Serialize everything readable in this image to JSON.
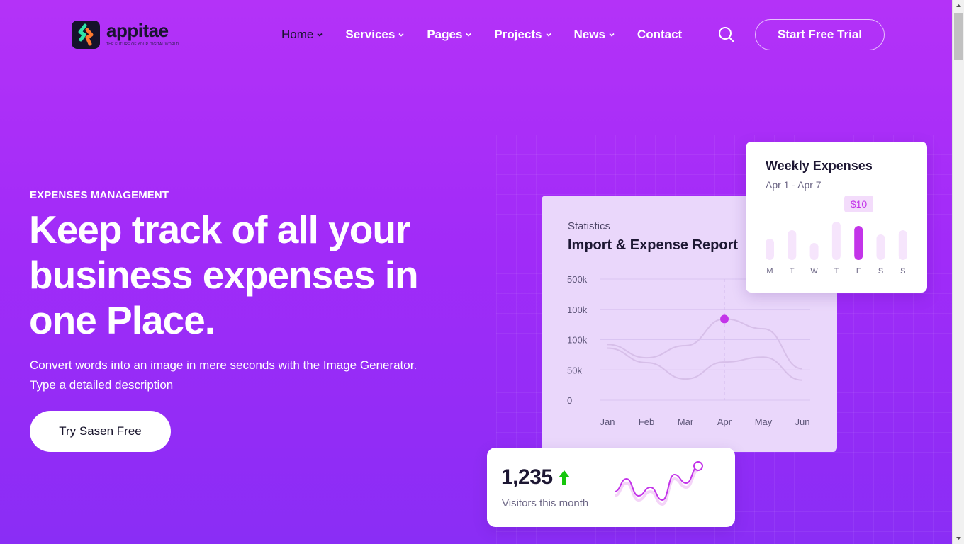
{
  "brand": {
    "name": "appitae",
    "tagline": "THE FUTURE OF YOUR DIGITAL WORLD"
  },
  "nav": {
    "items": [
      {
        "label": "Home",
        "has_dropdown": true,
        "active": true
      },
      {
        "label": "Services",
        "has_dropdown": true
      },
      {
        "label": "Pages",
        "has_dropdown": true
      },
      {
        "label": "Projects",
        "has_dropdown": true
      },
      {
        "label": "News",
        "has_dropdown": true
      },
      {
        "label": "Contact",
        "has_dropdown": false
      }
    ],
    "search_icon": "search-icon",
    "cta_label": "Start Free Trial"
  },
  "hero": {
    "eyebrow": "EXPENSES MANAGEMENT",
    "headline_lines": [
      "Keep track of all your",
      "business expenses in",
      "one Place."
    ],
    "subtext_lines": [
      "Convert words into an image in mere seconds with the Image Generator.",
      "Type a detailed description"
    ],
    "cta_label": "Try Sasen Free"
  },
  "stats_card": {
    "label": "Statistics",
    "title": "Import & Expense Report"
  },
  "weekly_card": {
    "title": "Weekly Expenses",
    "range": "Apr 1 - Apr 7",
    "tooltip": "$10"
  },
  "visitors_card": {
    "value": "1,235",
    "label": "Visitors this month",
    "trend_icon": "arrow-up-icon"
  },
  "colors": {
    "accent": "#c334e9",
    "background_top": "#b432f8",
    "background_bottom": "#8a2df5",
    "dark_text": "#1d1733",
    "trend_green": "#16c60c"
  },
  "chart_data": [
    {
      "type": "line",
      "title": "Import & Expense Report",
      "categories": [
        "Jan",
        "Feb",
        "Mar",
        "Apr",
        "May",
        "Jun"
      ],
      "y_tick_labels": [
        "500k",
        "100k",
        "100k",
        "50k",
        "0"
      ],
      "series": [
        {
          "values": [
            92,
            70,
            90,
            134,
            118,
            52
          ]
        },
        {
          "values": [
            86,
            62,
            35,
            63,
            71,
            33
          ]
        }
      ],
      "highlight": {
        "category": "Apr",
        "series_index": 0
      },
      "grid": true
    },
    {
      "type": "bar",
      "title": "Weekly Expenses",
      "categories": [
        "M",
        "T",
        "W",
        "T",
        "F",
        "S",
        "S"
      ],
      "values": [
        5,
        7,
        4,
        9,
        8,
        6,
        7
      ],
      "highlight_index": 4,
      "highlight_label": "$10"
    },
    {
      "type": "line",
      "label": "Visitors this month",
      "values": [
        3,
        6,
        2,
        4,
        1,
        7,
        5,
        9
      ]
    }
  ]
}
